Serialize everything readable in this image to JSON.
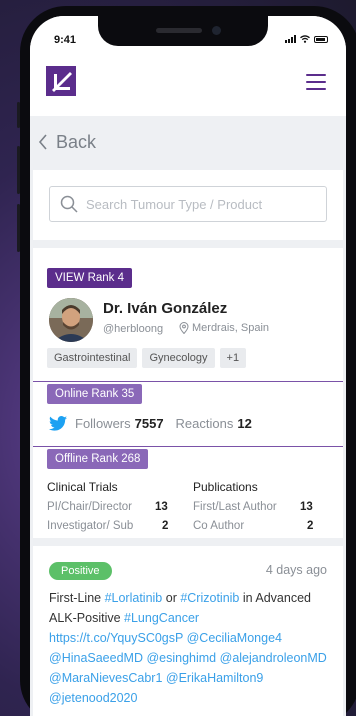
{
  "status": {
    "time": "9:41"
  },
  "header": {
    "logo": "app-logo",
    "menu_icon": "hamburger-menu-icon"
  },
  "nav": {
    "back_label": "Back"
  },
  "search": {
    "placeholder": "Search Tumour Type / Product"
  },
  "profile": {
    "view_rank": "VIEW Rank 4",
    "name": "Dr. Iván González",
    "handle": "@herbloong",
    "location": "Merdrais, Spain",
    "tags": [
      "Gastrointestinal",
      "Gynecology",
      "+1"
    ],
    "online_rank": "Online Rank 35",
    "followers_label": "Followers",
    "followers_value": "7557",
    "reactions_label": "Reactions",
    "reactions_value": "12",
    "offline_rank": "Offline Rank 268",
    "clinical_trials": {
      "title": "Clinical Trials",
      "rows": [
        {
          "label": "PI/Chair/Director",
          "value": "13"
        },
        {
          "label": "Investigator/ Sub",
          "value": "2"
        }
      ]
    },
    "publications": {
      "title": "Publications",
      "rows": [
        {
          "label": "First/Last Author",
          "value": "13"
        },
        {
          "label": "Co Author",
          "value": "2"
        }
      ]
    }
  },
  "post": {
    "sentiment": "Positive",
    "time": "4 days ago",
    "text_1": "First-Line ",
    "tag_1": "#Lorlatinib",
    "text_2": " or ",
    "tag_2": "#Crizotinib",
    "text_3": " in Advanced ALK-Positive ",
    "tag_3": "#LungCancer",
    "link": "https://t.co/YquySC0gsP",
    "mention_1": "@CeciliaMonge4",
    "mention_2": "@HinaSaeedMD",
    "mention_3": "@esinghimd",
    "mention_4": "@alejandroleonMD",
    "mention_5": "@MaraNievesCabr1",
    "mention_6": "@ErikaHamilton9",
    "mention_7": "@jetenood2020"
  },
  "colors": {
    "brand": "#5b2d8c",
    "rank_light": "#8a68b8",
    "positive": "#5cc068",
    "link": "#3aa0e8"
  }
}
